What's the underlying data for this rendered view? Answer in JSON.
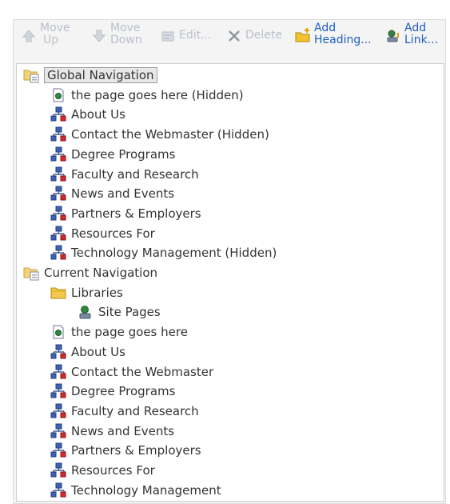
{
  "toolbar": {
    "move_up": {
      "line1": "Move",
      "line2": "Up"
    },
    "move_down": {
      "line1": "Move",
      "line2": "Down"
    },
    "edit": "Edit...",
    "delete": "Delete",
    "add_heading": {
      "line1": "Add",
      "line2": "Heading..."
    },
    "add_link": {
      "line1": "Add",
      "line2": "Link..."
    }
  },
  "tree": {
    "global_navigation": {
      "label": "Global Navigation",
      "items": [
        {
          "label": "the page goes here (Hidden)",
          "icon": "page-icon"
        },
        {
          "label": "About Us",
          "icon": "site-icon"
        },
        {
          "label": "Contact the Webmaster (Hidden)",
          "icon": "site-icon"
        },
        {
          "label": "Degree Programs",
          "icon": "site-icon"
        },
        {
          "label": "Faculty and Research",
          "icon": "site-icon"
        },
        {
          "label": "News and Events",
          "icon": "site-icon"
        },
        {
          "label": "Partners & Employers",
          "icon": "site-icon"
        },
        {
          "label": "Resources For",
          "icon": "site-icon"
        },
        {
          "label": "Technology Management (Hidden)",
          "icon": "site-icon"
        }
      ]
    },
    "current_navigation": {
      "label": "Current Navigation",
      "libraries": {
        "label": "Libraries",
        "child": "Site Pages"
      },
      "items": [
        {
          "label": "the page goes here",
          "icon": "page-icon"
        },
        {
          "label": "About Us",
          "icon": "site-icon"
        },
        {
          "label": "Contact the Webmaster",
          "icon": "site-icon"
        },
        {
          "label": "Degree Programs",
          "icon": "site-icon"
        },
        {
          "label": "Faculty and Research",
          "icon": "site-icon"
        },
        {
          "label": "News and Events",
          "icon": "site-icon"
        },
        {
          "label": "Partners & Employers",
          "icon": "site-icon"
        },
        {
          "label": "Resources For",
          "icon": "site-icon"
        },
        {
          "label": "Technology Management",
          "icon": "site-icon"
        }
      ]
    }
  },
  "colors": {
    "link_blue": "#1d5fbf",
    "disabled_gray": "#b8bfcb",
    "text": "#333333"
  }
}
